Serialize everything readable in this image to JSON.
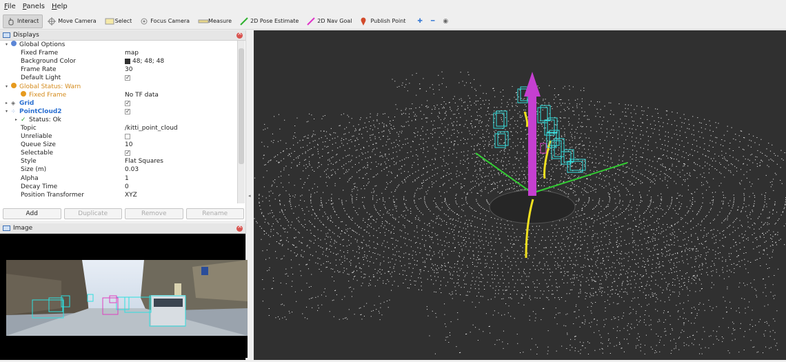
{
  "menu": [
    {
      "label": "File",
      "mnemonic": "F",
      "rest": "ile"
    },
    {
      "label": "Panels",
      "mnemonic": "P",
      "rest": "anels"
    },
    {
      "label": "Help",
      "mnemonic": "H",
      "rest": "elp"
    }
  ],
  "toolbar": {
    "tools": [
      {
        "label": "Interact",
        "icon": "hand-icon",
        "active": true
      },
      {
        "label": "Move Camera",
        "icon": "move-camera-icon"
      },
      {
        "label": "Select",
        "icon": "select-icon"
      },
      {
        "label": "Focus Camera",
        "icon": "focus-icon"
      },
      {
        "label": "Measure",
        "icon": "measure-icon"
      },
      {
        "label": "2D Pose Estimate",
        "icon": "pose-arrow-icon"
      },
      {
        "label": "2D Nav Goal",
        "icon": "nav-arrow-icon"
      },
      {
        "label": "Publish Point",
        "icon": "pin-icon"
      }
    ],
    "colors": {
      "pose": "#2fb12f",
      "nav": "#e033c9",
      "pin": "#d24a2a",
      "plus": "#3a7bd5"
    }
  },
  "displays": {
    "title": "Displays",
    "rows": [
      {
        "indent": 0,
        "arrow": "▾",
        "icon": "globe-icon",
        "key": "Global Options",
        "value": ""
      },
      {
        "indent": 1,
        "key": "Fixed Frame",
        "value": "map"
      },
      {
        "indent": 1,
        "key": "Background Color",
        "value": "48; 48; 48",
        "swatch": "#303030"
      },
      {
        "indent": 1,
        "key": "Frame Rate",
        "value": "30"
      },
      {
        "indent": 1,
        "key": "Default Light",
        "value": "",
        "check": true
      },
      {
        "indent": 0,
        "arrow": "▾",
        "icon": "warning-icon",
        "key": "Global Status: Warn",
        "value": "",
        "style": "warn"
      },
      {
        "indent": 1,
        "icon": "warning-icon",
        "key": "Fixed Frame",
        "value": "No TF data",
        "style": "warn"
      },
      {
        "indent": 0,
        "arrow": "▸",
        "icon": "grid-icon",
        "key": "Grid",
        "value": "",
        "check": true,
        "style": "blue"
      },
      {
        "indent": 0,
        "arrow": "▾",
        "icon": "pointcloud-icon",
        "key": "PointCloud2",
        "value": "",
        "check": true,
        "style": "blue"
      },
      {
        "indent": 1,
        "arrow": "▸",
        "icon": "ok-icon",
        "key": "Status: Ok",
        "value": ""
      },
      {
        "indent": 1,
        "key": "Topic",
        "value": "/kitti_point_cloud"
      },
      {
        "indent": 1,
        "key": "Unreliable",
        "value": "",
        "check": false
      },
      {
        "indent": 1,
        "key": "Queue Size",
        "value": "10"
      },
      {
        "indent": 1,
        "key": "Selectable",
        "value": "",
        "check": true
      },
      {
        "indent": 1,
        "key": "Style",
        "value": "Flat Squares"
      },
      {
        "indent": 1,
        "key": "Size (m)",
        "value": "0.03"
      },
      {
        "indent": 1,
        "key": "Alpha",
        "value": "1"
      },
      {
        "indent": 1,
        "key": "Decay Time",
        "value": "0"
      },
      {
        "indent": 1,
        "key": "Position Transformer",
        "value": "XYZ"
      }
    ],
    "buttons": [
      {
        "label": "Add",
        "enabled": true
      },
      {
        "label": "Duplicate",
        "enabled": false
      },
      {
        "label": "Remove",
        "enabled": false
      },
      {
        "label": "Rename",
        "enabled": false
      }
    ]
  },
  "image_panel": {
    "title": "Image"
  },
  "viewport": {
    "background": "#303030",
    "arrow_color": "#c53fd0",
    "axis_green": "#33cc33",
    "box_color": "#33e0e0",
    "track_color": "#f0e020"
  }
}
